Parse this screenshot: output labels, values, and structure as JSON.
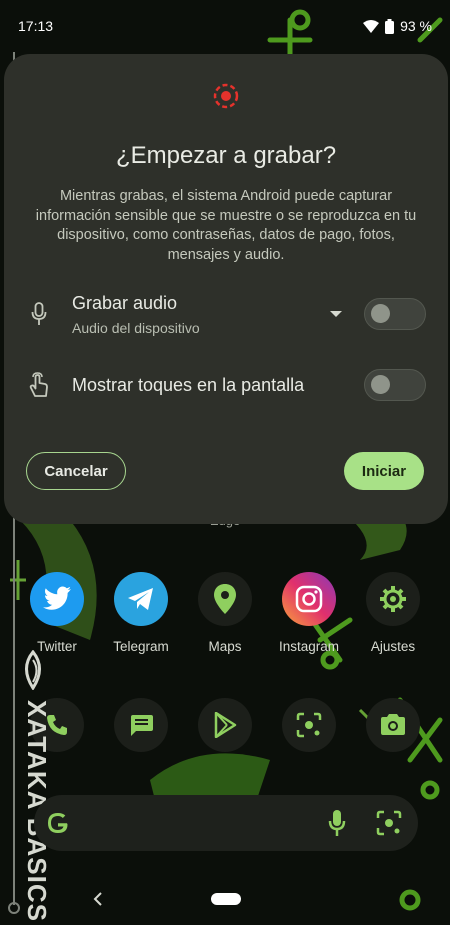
{
  "status_bar": {
    "time": "17:13",
    "battery": "93 %"
  },
  "dialog": {
    "title": "¿Empezar a grabar?",
    "body": "Mientras grabas, el sistema Android puede capturar información sensible que se muestre o se reproduzca en tu dispositivo, como contraseñas, datos de pago, fotos, mensajes y audio.",
    "audio_option": {
      "title": "Grabar audio",
      "subtitle": "Audio del dispositivo",
      "enabled": false
    },
    "touches_option": {
      "title": "Mostrar toques en la pantalla",
      "enabled": false
    },
    "cancel_label": "Cancelar",
    "start_label": "Iniciar",
    "accent_color": "#a8e187",
    "record_color": "#e5322c"
  },
  "home": {
    "partial_label": "Edge",
    "apps_row1": [
      {
        "label": "Twitter",
        "icon": "twitter-icon",
        "color": "#1d9bf0"
      },
      {
        "label": "Telegram",
        "icon": "telegram-icon",
        "color": "#2aa3df"
      },
      {
        "label": "Maps",
        "icon": "maps-icon",
        "color": "#1c1f1a"
      },
      {
        "label": "Instagram",
        "icon": "instagram-icon",
        "color": "#e1306c"
      },
      {
        "label": "Ajustes",
        "icon": "settings-icon",
        "color": "#1c1f1a"
      }
    ],
    "dock": [
      {
        "icon": "phone-icon"
      },
      {
        "icon": "messages-icon"
      },
      {
        "icon": "play-store-icon"
      },
      {
        "icon": "lens-icon"
      },
      {
        "icon": "camera-icon"
      }
    ]
  },
  "watermark": {
    "text": "XATAKA BASICS"
  }
}
